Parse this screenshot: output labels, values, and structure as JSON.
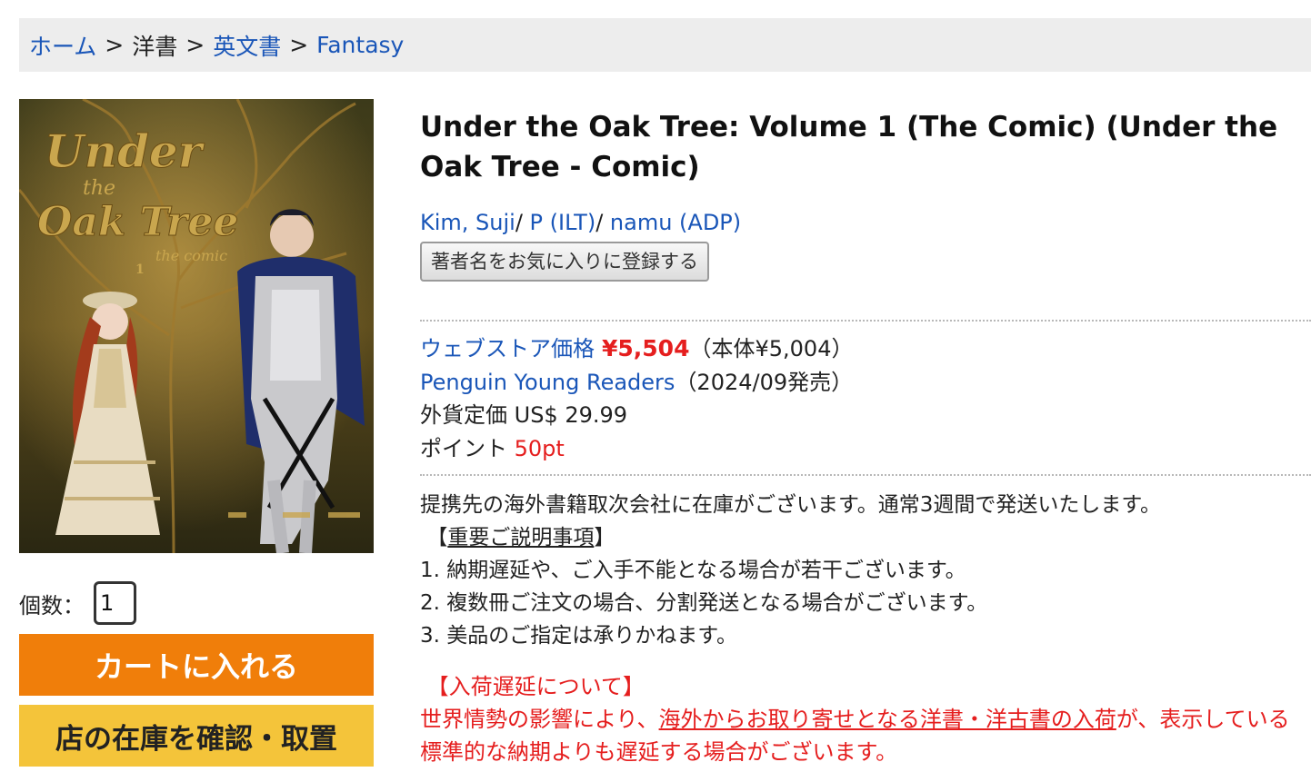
{
  "breadcrumb": {
    "home": "ホーム",
    "sep": ">",
    "western_books": "洋書",
    "english_books": "英文書",
    "genre": "Fantasy"
  },
  "cover": {
    "title_line1": "Under",
    "title_line2": "the",
    "title_line3": "Oak Tree",
    "subtitle": "the comic",
    "volume": "1"
  },
  "purchase": {
    "qty_label": "個数：",
    "qty_value": "1",
    "cart_button": "カートに入れる",
    "store_button": "店の在庫を確認・取置"
  },
  "product": {
    "title": "Under the Oak Tree: Volume 1 (The Comic) (Under the Oak Tree - Comic)",
    "authors": [
      {
        "name": "Kim, Suji"
      },
      {
        "name": "P (ILT)"
      },
      {
        "name": "namu (ADP)"
      }
    ],
    "author_sep": "/ ",
    "fav_button": "著者名をお気に入りに登録する",
    "price_label": "ウェブストア価格",
    "price": "¥5,504",
    "price_base": "（本体¥5,004）",
    "publisher": "Penguin Young Readers",
    "release": "（2024/09発売）",
    "foreign_price": "外貨定価 US$ 29.99",
    "points_label": "ポイント",
    "points_value": "50pt"
  },
  "notes": {
    "stock": "提携先の海外書籍取次会社に在庫がございます。通常3週間で発送いたします。",
    "important_open": "【",
    "important_link": "重要ご説明事項",
    "important_close": "】",
    "items": [
      "1. 納期遅延や、ご入手不能となる場合が若干ございます。",
      "2. 複数冊ご注文の場合、分割発送となる場合がございます。",
      "3. 美品のご指定は承りかねます。"
    ]
  },
  "delay": {
    "heading": "【入荷遅延について】",
    "text_before": "世界情勢の影響により、",
    "text_link": "海外からお取り寄せとなる洋書・洋古書の入荷",
    "text_after": "が、表示している標準的な納期よりも遅延する場合がございます。"
  },
  "colors": {
    "link": "#1a56b8",
    "price_red": "#e51e1e",
    "cart_orange": "#f07e0a",
    "store_yellow": "#f4c43a",
    "breadcrumb_bg": "#ededed"
  }
}
